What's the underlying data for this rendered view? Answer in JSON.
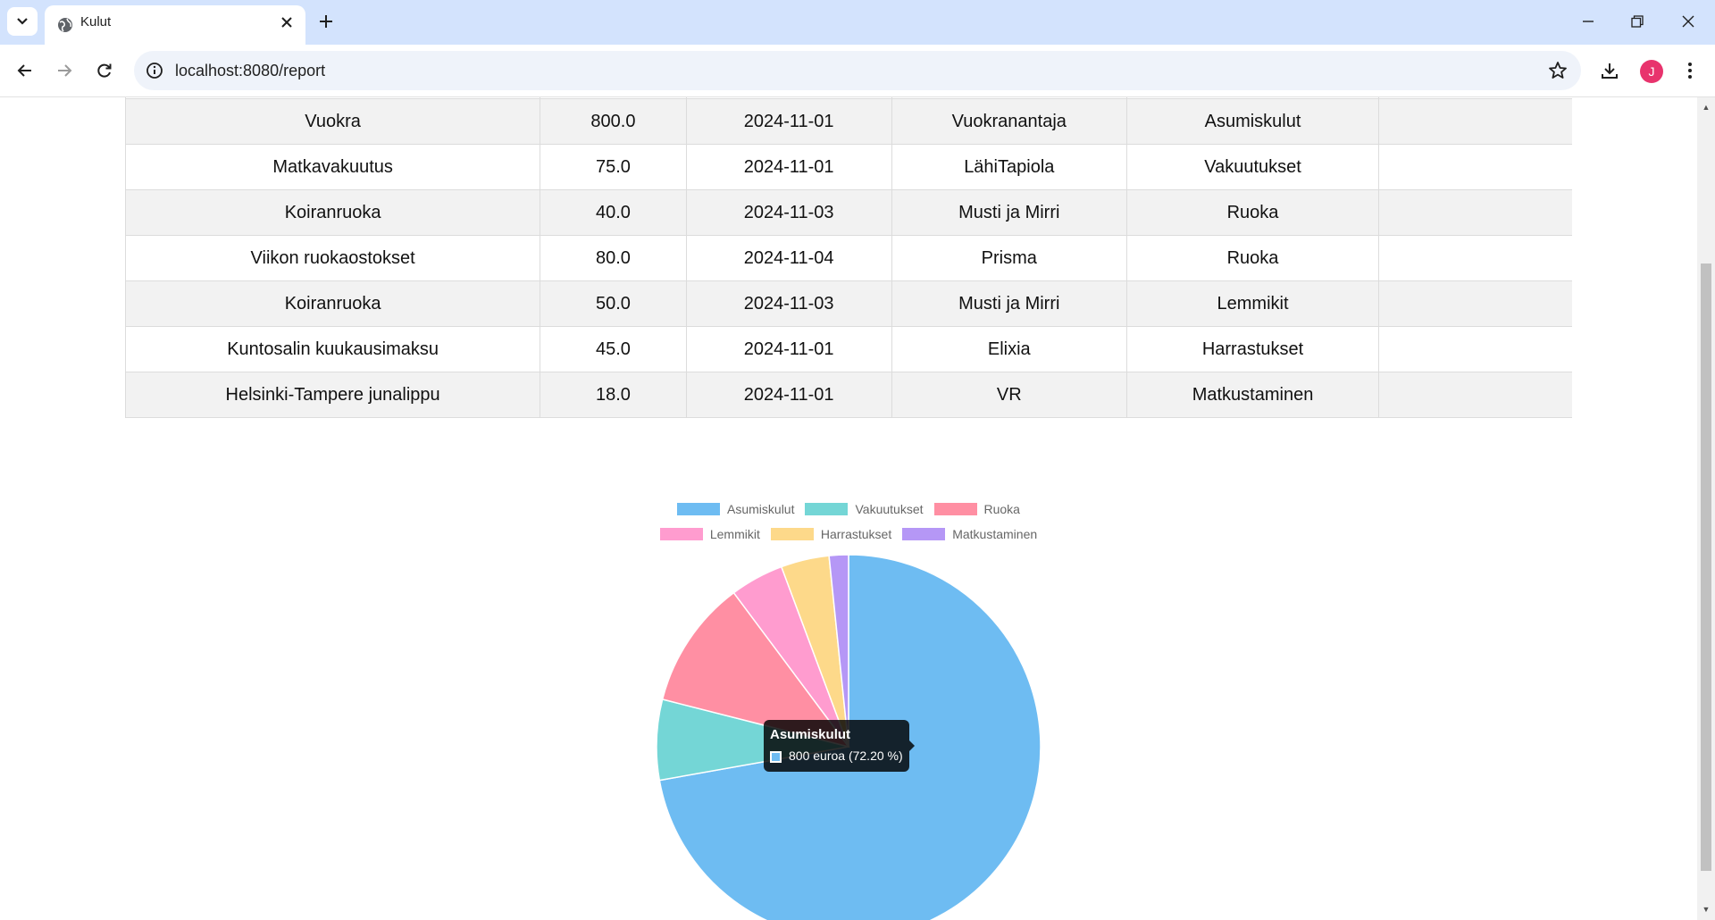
{
  "browser": {
    "tab_title": "Kulut",
    "url": "localhost:8080/report"
  },
  "table": {
    "rows": [
      [
        "Vuokra",
        "800.0",
        "2024-11-01",
        "Vuokranantaja",
        "Asumiskulut",
        ""
      ],
      [
        "Matkavakuutus",
        "75.0",
        "2024-11-01",
        "LähiTapiola",
        "Vakuutukset",
        ""
      ],
      [
        "Koiranruoka",
        "40.0",
        "2024-11-03",
        "Musti ja Mirri",
        "Ruoka",
        ""
      ],
      [
        "Viikon ruokaostokset",
        "80.0",
        "2024-11-04",
        "Prisma",
        "Ruoka",
        ""
      ],
      [
        "Koiranruoka",
        "50.0",
        "2024-11-03",
        "Musti ja Mirri",
        "Lemmikit",
        ""
      ],
      [
        "Kuntosalin kuukausimaksu",
        "45.0",
        "2024-11-01",
        "Elixia",
        "Harrastukset",
        ""
      ],
      [
        "Helsinki-Tampere junalippu",
        "18.0",
        "2024-11-01",
        "VR",
        "Matkustaminen",
        ""
      ]
    ]
  },
  "chart_data": {
    "type": "pie",
    "categories": [
      "Asumiskulut",
      "Vakuutukset",
      "Ruoka",
      "Lemmikit",
      "Harrastukset",
      "Matkustaminen"
    ],
    "values": [
      800,
      75,
      120,
      50,
      45,
      18
    ],
    "colors": [
      "#6ebcf2",
      "#74d6d6",
      "#ff8fa3",
      "#ff9ccf",
      "#fdd98a",
      "#b597f6"
    ],
    "legend_position": "top"
  },
  "tooltip": {
    "title": "Asumiskulut",
    "body": "800 euroa (72.20 %)"
  }
}
